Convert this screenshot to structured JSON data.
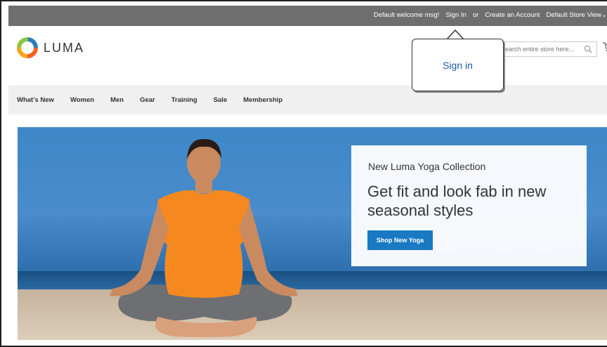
{
  "topbar": {
    "welcome": "Default welcome msg!",
    "sign_in": "Sign In",
    "or": "or",
    "create_account": "Create an Account",
    "store_view": "Default Store View",
    "store_view_chevron": "⌄"
  },
  "header": {
    "logo_text": "LUMA",
    "search_placeholder": "Search entire store here...",
    "icons": [
      "luma-logo-icon",
      "search-icon",
      "cart-icon"
    ]
  },
  "nav": {
    "items": [
      "What's New",
      "Women",
      "Men",
      "Gear",
      "Training",
      "Sale",
      "Membership"
    ]
  },
  "hero": {
    "subtitle": "New Luma Yoga Collection",
    "headline": "Get fit and look fab in new seasonal styles",
    "cta": "Shop New Yoga"
  },
  "tooltip": {
    "text": "Sign in"
  },
  "colors": {
    "topbar": "#6e6e6e",
    "nav_bg": "#f0f0f0",
    "cta": "#1979c3",
    "tooltip_text": "#1a56a6"
  }
}
